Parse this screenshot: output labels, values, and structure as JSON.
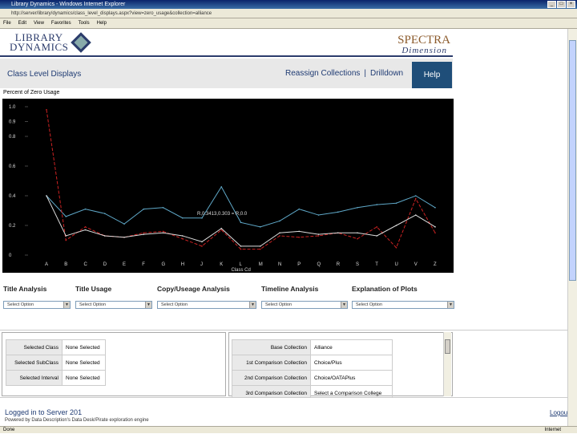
{
  "window": {
    "title": "Library Dynamics - Windows Internet Explorer"
  },
  "browser": {
    "address": "http://server/library/dynamics/class_level_displays.aspx?view=zero_usage&collection=alliance",
    "menu": [
      "File",
      "Edit",
      "View",
      "Favorites",
      "Tools",
      "Help"
    ]
  },
  "header": {
    "logo_left": "LIBRARY\nDYNAMICS",
    "logo_right_top": "SPECTRA",
    "logo_right_bottom": "Dimension"
  },
  "nav": {
    "left": "Class Level Displays",
    "reassign": "Reassign Collections",
    "sep": "|",
    "drilldown": "Drilldown",
    "help": "Help"
  },
  "chart_title": "Percent of Zero Usage",
  "chart_data": {
    "type": "line",
    "title": "Percent of Zero Usage",
    "xlabel": "Class Cd",
    "ylabel": "",
    "ylim": [
      0,
      1.0
    ],
    "yticks": [
      "0",
      "0.1",
      "0.2",
      "0.3",
      "0.4",
      "0.5",
      "0.6",
      "0.7",
      "0.8",
      "0.9",
      "1.0"
    ],
    "ytick_labels_visible": [
      "1.0",
      "0.9",
      "0.8",
      "0.6",
      "0.4",
      "0.2",
      "0"
    ],
    "categories": [
      "A",
      "B",
      "C",
      "D",
      "E",
      "F",
      "G",
      "H",
      "J",
      "K",
      "L",
      "M",
      "N",
      "P",
      "Q",
      "R",
      "S",
      "T",
      "U",
      "V",
      "Z"
    ],
    "grid": false,
    "series": [
      {
        "name": "Alliance",
        "color": "#5fa8c8",
        "values": [
          0.4,
          0.26,
          0.31,
          0.28,
          0.21,
          0.31,
          0.32,
          0.25,
          0.25,
          0.46,
          0.22,
          0.19,
          0.23,
          0.31,
          0.27,
          0.29,
          0.32,
          0.34,
          0.35,
          0.4,
          0.32
        ]
      },
      {
        "name": "Choice/Plus",
        "color": "#cc2222",
        "values": [
          0.98,
          0.1,
          0.19,
          0.13,
          0.12,
          0.15,
          0.16,
          0.11,
          0.06,
          0.17,
          0.04,
          0.04,
          0.13,
          0.12,
          0.13,
          0.15,
          0.11,
          0.19,
          0.05,
          0.38,
          0.15
        ]
      },
      {
        "name": "Choice/OATAPlus",
        "color": "#dddddd",
        "values": [
          0.4,
          0.13,
          0.17,
          0.13,
          0.12,
          0.14,
          0.15,
          0.13,
          0.09,
          0.18,
          0.06,
          0.06,
          0.15,
          0.16,
          0.14,
          0.15,
          0.15,
          0.13,
          0.2,
          0.27,
          0.19
        ]
      }
    ],
    "annotation": "R,0.3413,0.303 = R,0.0"
  },
  "analysis": {
    "title_analysis": "Title Analysis",
    "title_usage": "Title Usage",
    "copy_usage": "Copy/Useage Analysis",
    "timeline": "Timeline Analysis",
    "explanation": "Explanation of Plots",
    "select_placeholder": "Select Option"
  },
  "left_table": [
    {
      "k": "Selected Class",
      "v": "None Selected"
    },
    {
      "k": "Selected SubClass",
      "v": "None Selected"
    },
    {
      "k": "Selected Interval",
      "v": "None Selected"
    }
  ],
  "right_table": [
    {
      "k": "Base Collection",
      "v": "Alliance"
    },
    {
      "k": "1st Comparison Collection",
      "v": "Choice/Plus"
    },
    {
      "k": "2nd Comparison Collection",
      "v": "Choice/OATAPlus"
    },
    {
      "k": "3rd Comparison Collection",
      "v": "Select a Comparison College"
    }
  ],
  "footer": {
    "logged": "Logged in to Server 201",
    "powered": "Powered by Data Description's Data Desk/Pirate exploration engine",
    "logout": "Logout"
  },
  "status": {
    "left": "Done",
    "zone": "Internet"
  }
}
